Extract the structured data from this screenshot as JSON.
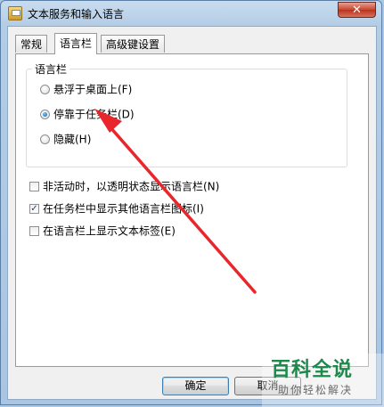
{
  "window": {
    "title": "文本服务和输入语言",
    "close_label": "✕"
  },
  "tabs": [
    {
      "label": "常规",
      "active": false
    },
    {
      "label": "语言栏",
      "active": true
    },
    {
      "label": "高级键设置",
      "active": false
    }
  ],
  "language_bar_group": {
    "caption": "语言栏",
    "options": [
      {
        "label": "悬浮于桌面上(F)",
        "selected": false
      },
      {
        "label": "停靠于任务栏(D)",
        "selected": true
      },
      {
        "label": "隐藏(H)",
        "selected": false
      }
    ]
  },
  "checkboxes": [
    {
      "label": "非活动时，以透明状态显示语言栏(N)",
      "checked": false
    },
    {
      "label": "在任务栏中显示其他语言栏图标(I)",
      "checked": true
    },
    {
      "label": "在语言栏上显示文本标签(E)",
      "checked": false
    }
  ],
  "buttons": {
    "ok_label": "确定",
    "cancel_label": "取消"
  },
  "watermark": {
    "brand": "百科全说",
    "slogan": "助你轻松解决"
  },
  "colors": {
    "annotation_arrow": "#e8262b",
    "watermark_green": "#1b8a4a"
  },
  "check_glyph": "✓"
}
